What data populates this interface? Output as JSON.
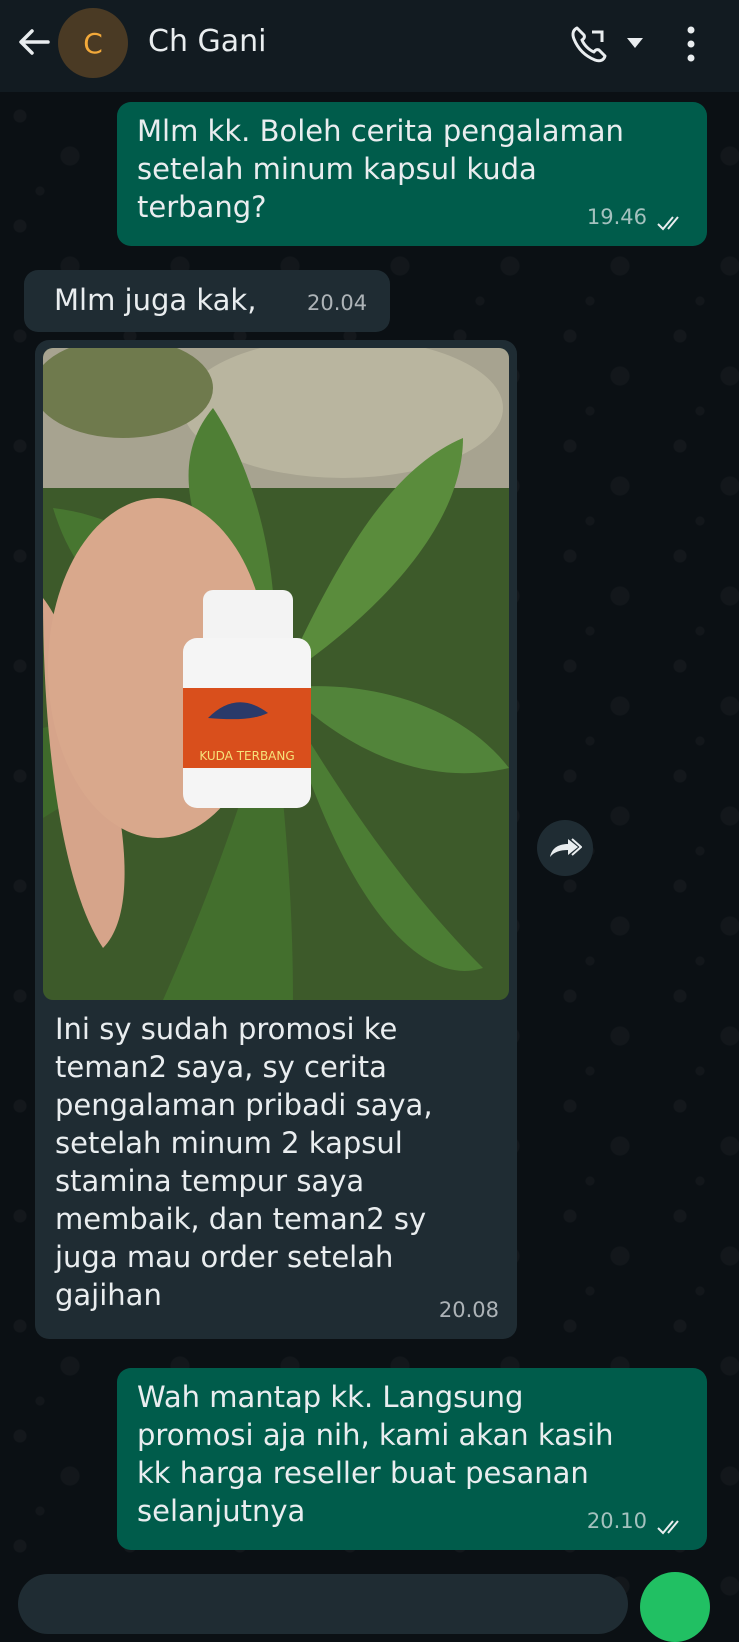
{
  "header": {
    "avatar_letter": "C",
    "contact_name": "Ch Gani",
    "icons": [
      "back-arrow-icon",
      "phone-icon",
      "chevron-down-icon",
      "more-vert-icon"
    ]
  },
  "messages": [
    {
      "direction": "outgoing",
      "lines": [
        "Mlm kk. Boleh cerita pengalaman",
        "setelah minum kapsul kuda",
        "terbang?"
      ],
      "time": "19.46",
      "status": "read"
    },
    {
      "direction": "incoming",
      "lines": [
        "Mlm juga kak,"
      ],
      "time": "20.04"
    },
    {
      "direction": "incoming",
      "type": "image",
      "image_label": "KUDA TERBANG",
      "lines": [
        "Ini sy sudah promosi ke",
        "teman2 saya, sy cerita",
        "pengalaman pribadi saya,",
        "setelah minum 2 kapsul",
        "stamina tempur saya",
        "membaik, dan teman2 sy",
        "juga mau order setelah",
        "gajihan"
      ],
      "time": "20.08"
    },
    {
      "direction": "outgoing",
      "lines": [
        "Wah mantap kk. Langsung",
        "promosi aja nih, kami akan kasih",
        "kk harga reseller buat pesanan",
        "selanjutnya"
      ],
      "time": "20.10",
      "status": "read"
    }
  ],
  "colors": {
    "header_bg": "#121b21",
    "chat_bg": "#0b1014",
    "outgoing_bubble": "#005c4b",
    "incoming_bubble": "#1f2c33",
    "read_ticks": "#e9edef",
    "accent_green": "#21c063"
  }
}
